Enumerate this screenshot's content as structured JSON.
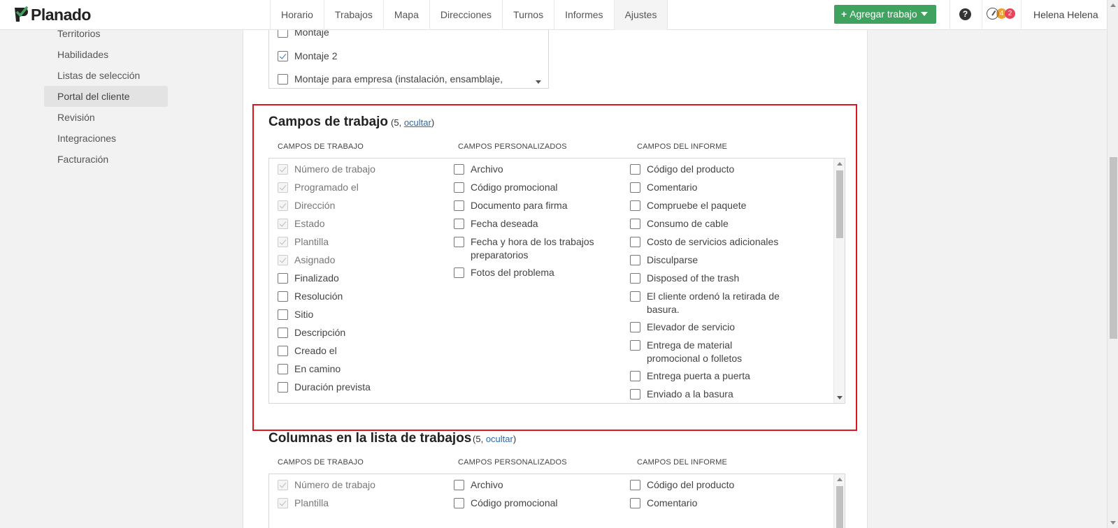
{
  "app": {
    "name": "Planado"
  },
  "nav": [
    "Horario",
    "Trabajos",
    "Mapa",
    "Direcciones",
    "Turnos",
    "Informes",
    "Ajustes"
  ],
  "header": {
    "add_button": "Agregar trabajo",
    "help": "?",
    "badge_orange": "4",
    "badge_red": "2",
    "user": "Helena Helena"
  },
  "sidebar": [
    "Territorios",
    "Habilidades",
    "Listas de selección",
    "Portal del cliente",
    "Revisión",
    "Integraciones",
    "Facturación"
  ],
  "top_list": [
    {
      "label": "Montaje",
      "checked": false
    },
    {
      "label": "Montaje 2",
      "checked": true
    },
    {
      "label": "Montaje para empresa (instalación, ensamblaje,",
      "checked": false
    }
  ],
  "section1": {
    "title": "Campos de trabajo",
    "count": "5",
    "link": "ocultar",
    "col_headers": [
      "CAMPOS DE TRABAJO",
      "CAMPOS PERSONALIZADOS",
      "CAMPOS DEL INFORME"
    ],
    "col1": [
      "Número de trabajo",
      "Programado el",
      "Dirección",
      "Estado",
      "Plantilla",
      "Asignado",
      "Finalizado",
      "Resolución",
      "Sitio",
      "Descripción",
      "Creado el",
      "En camino",
      "Duración prevista"
    ],
    "col2": [
      "Archivo",
      "Código promocional",
      "Documento para firma",
      "Fecha deseada",
      "Fecha y hora de los trabajos preparatorios",
      "Fotos del problema"
    ],
    "col3": [
      "Código del producto",
      "Comentario",
      "Compruebe el paquete",
      "Consumo de cable",
      "Costo de servicios adicionales",
      "Disculparse",
      "Disposed of the trash",
      "El cliente ordenó la retirada de basura.",
      "Elevador de servicio",
      "Entrega de material promocional o folletos",
      "Entrega puerta a puerta",
      "Enviado a la basura"
    ]
  },
  "section2": {
    "title": "Columnas en la lista de trabajos",
    "count": "5",
    "link": "ocultar",
    "col_headers": [
      "CAMPOS DE TRABAJO",
      "CAMPOS PERSONALIZADOS",
      "CAMPOS DEL INFORME"
    ],
    "col1": [
      "Número de trabajo",
      "Plantilla"
    ],
    "col2": [
      "Archivo",
      "Código promocional"
    ],
    "col3": [
      "Código del producto",
      "Comentario"
    ]
  },
  "colors": {
    "brand_green": "#3fa35f",
    "highlight": "#e0141c",
    "link": "#2d6aa8"
  }
}
